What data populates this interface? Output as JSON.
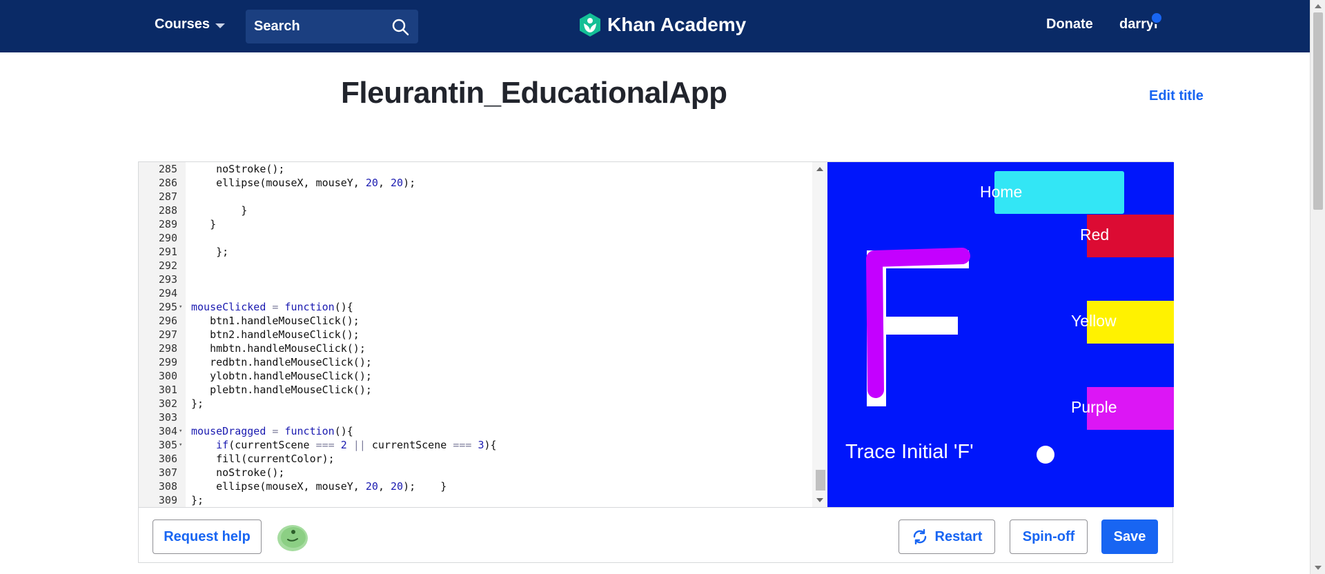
{
  "nav": {
    "courses_label": "Courses",
    "search_label": "Search",
    "brand": "Khan Academy",
    "donate_label": "Donate",
    "user_name": "darryl"
  },
  "page": {
    "title": "Fleurantin_EducationalApp",
    "edit_title_label": "Edit title"
  },
  "editor": {
    "lines": [
      {
        "n": "285",
        "fold": false,
        "html": "    noStroke();"
      },
      {
        "n": "286",
        "fold": false,
        "html": "    ellipse(mouseX, mouseY, <span class='num'>20</span>, <span class='num'>20</span>);"
      },
      {
        "n": "287",
        "fold": false,
        "html": ""
      },
      {
        "n": "288",
        "fold": false,
        "html": "        }"
      },
      {
        "n": "289",
        "fold": false,
        "html": "   }"
      },
      {
        "n": "290",
        "fold": false,
        "html": ""
      },
      {
        "n": "291",
        "fold": false,
        "html": "    };"
      },
      {
        "n": "292",
        "fold": false,
        "html": ""
      },
      {
        "n": "293",
        "fold": false,
        "html": ""
      },
      {
        "n": "294",
        "fold": false,
        "html": ""
      },
      {
        "n": "295",
        "fold": true,
        "html": "<span class='kw'>mouseClicked</span> <span class='op'>=</span> <span class='kw'>function</span>(){"
      },
      {
        "n": "296",
        "fold": false,
        "html": "   btn1.handleMouseClick();"
      },
      {
        "n": "297",
        "fold": false,
        "html": "   btn2.handleMouseClick();"
      },
      {
        "n": "298",
        "fold": false,
        "html": "   hmbtn.handleMouseClick();"
      },
      {
        "n": "299",
        "fold": false,
        "html": "   redbtn.handleMouseClick();"
      },
      {
        "n": "300",
        "fold": false,
        "html": "   ylobtn.handleMouseClick();"
      },
      {
        "n": "301",
        "fold": false,
        "html": "   plebtn.handleMouseClick();"
      },
      {
        "n": "302",
        "fold": false,
        "html": "};"
      },
      {
        "n": "303",
        "fold": false,
        "html": ""
      },
      {
        "n": "304",
        "fold": true,
        "html": "<span class='kw'>mouseDragged</span> <span class='op'>=</span> <span class='kw'>function</span>(){"
      },
      {
        "n": "305",
        "fold": true,
        "html": "    <span class='kw'>if</span>(currentScene <span class='op'>===</span> <span class='num'>2</span> <span class='op'>||</span> currentScene <span class='op'>===</span> <span class='num'>3</span>){"
      },
      {
        "n": "306",
        "fold": false,
        "html": "    fill(currentColor);"
      },
      {
        "n": "307",
        "fold": false,
        "html": "    noStroke();"
      },
      {
        "n": "308",
        "fold": false,
        "html": "    ellipse(mouseX, mouseY, <span class='num'>20</span>, <span class='num'>20</span>);    }"
      },
      {
        "n": "309",
        "fold": false,
        "html": "};"
      }
    ]
  },
  "canvas": {
    "home_label": "Home",
    "red_label": "Red",
    "yellow_label": "Yellow",
    "purple_label": "Purple",
    "trace_label": "Trace Initial 'F'",
    "colors": {
      "background": "#0016fb",
      "home": "#33e6f5",
      "red": "#dc0b33",
      "yellow": "#fff200",
      "purple": "#dc16f5",
      "trace_stroke": "#c400ff"
    }
  },
  "toolbar": {
    "request_help_label": "Request help",
    "restart_label": "Restart",
    "spinoff_label": "Spin-off",
    "save_label": "Save"
  },
  "colors": {
    "nav_bg": "#0a2a66",
    "accent": "#1865f2",
    "title_text": "#21242c"
  }
}
